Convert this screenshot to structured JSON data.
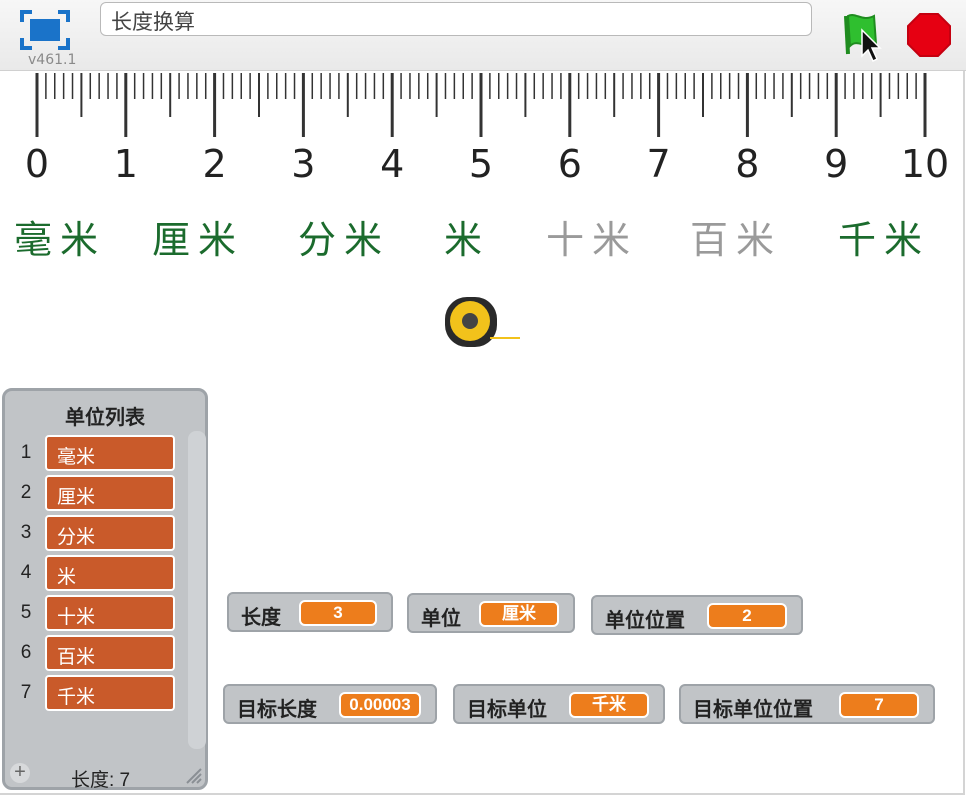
{
  "app": {
    "version": "v461.1",
    "project_title": "长度换算"
  },
  "toolbar": {
    "fullscreen_icon": "fullscreen-icon",
    "green_flag_icon": "green-flag-icon",
    "stop_icon": "stop-sign-icon",
    "flag_color": "#2fbf2f",
    "stop_color": "#e60012"
  },
  "stage": {
    "ruler": {
      "tick_labels": [
        "0",
        "1",
        "2",
        "3",
        "4",
        "5",
        "6",
        "7",
        "8",
        "9",
        "10"
      ]
    },
    "units": [
      {
        "label": "毫米",
        "color": "#1b6b2d"
      },
      {
        "label": "厘米",
        "color": "#1b6b2d"
      },
      {
        "label": "分米",
        "color": "#1b6b2d"
      },
      {
        "label": "米",
        "color": "#1b6b2d"
      },
      {
        "label": "十米",
        "color": "#9a9a9a"
      },
      {
        "label": "百米",
        "color": "#9a9a9a"
      },
      {
        "label": "千米",
        "color": "#1b6b2d"
      }
    ],
    "sprite_icon": "tape-measure-icon"
  },
  "list_monitor": {
    "title": "单位列表",
    "items": [
      {
        "index": "1",
        "value": "毫米"
      },
      {
        "index": "2",
        "value": "厘米"
      },
      {
        "index": "3",
        "value": "分米"
      },
      {
        "index": "4",
        "value": "米"
      },
      {
        "index": "5",
        "value": "十米"
      },
      {
        "index": "6",
        "value": "百米"
      },
      {
        "index": "7",
        "value": "千米"
      }
    ],
    "add_label": "+",
    "length_text": "长度: 7"
  },
  "variables": {
    "length": {
      "label": "长度",
      "value": "3"
    },
    "unit": {
      "label": "单位",
      "value": "厘米"
    },
    "unit_position": {
      "label": "单位位置",
      "value": "2"
    },
    "target_length": {
      "label": "目标长度",
      "value": "0.00003"
    },
    "target_unit": {
      "label": "目标单位",
      "value": "千米"
    },
    "target_unit_position": {
      "label": "目标单位位置",
      "value": "7"
    }
  }
}
